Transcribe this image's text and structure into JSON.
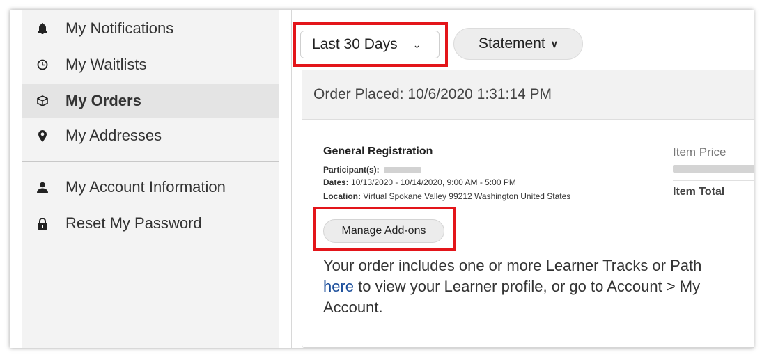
{
  "sidebar": {
    "items": [
      {
        "label": "My Notifications",
        "icon": "bell-icon",
        "active": false
      },
      {
        "label": "My Waitlists",
        "icon": "clock-icon",
        "active": false
      },
      {
        "label": "My Orders",
        "icon": "box-icon",
        "active": true
      },
      {
        "label": "My Addresses",
        "icon": "location-pin-icon",
        "active": false
      },
      {
        "label": "My Account Information",
        "icon": "user-icon",
        "active": false
      },
      {
        "label": "Reset My Password",
        "icon": "lock-icon",
        "active": false
      }
    ]
  },
  "toolbar": {
    "date_range": "Last 30 Days",
    "statement_label": "Statement"
  },
  "order": {
    "placed": "Order Placed: 10/6/2020 1:31:14 PM",
    "item_name": "General Registration",
    "participants_label": "Participant(s):",
    "dates_label": "Dates:",
    "dates_value": "10/13/2020 - 10/14/2020, 9:00 AM - 5:00 PM",
    "location_label": "Location:",
    "location_value": "Virtual Spokane Valley 99212 Washington United States",
    "item_price_label": "Item Price",
    "item_total_label": "Item Total",
    "manage_addons_label": "Manage Add-ons",
    "note_line1": "Your order includes one or more Learner Tracks or Path",
    "note_link": "here",
    "note_line2_rest": " to view your Learner profile, or go to Account > My",
    "note_line3": "Account."
  },
  "colors": {
    "highlight": "#e3151a",
    "link": "#1b4e9b",
    "sidebar_bg": "#f3f3f3",
    "sidebar_active": "#e4e4e4"
  }
}
